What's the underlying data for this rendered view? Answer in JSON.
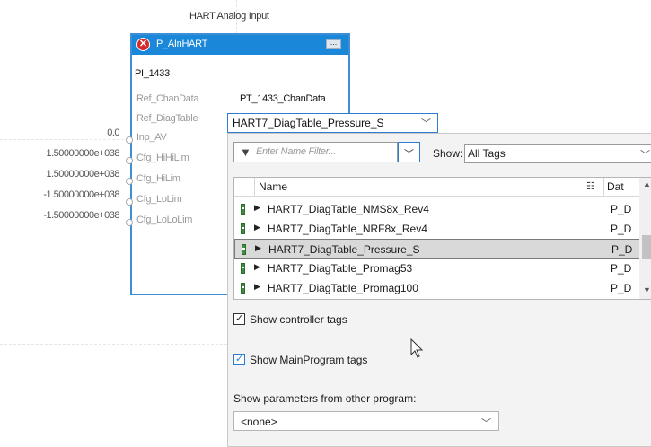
{
  "block": {
    "caption": "HART Analog Input",
    "name": "P_AInHART",
    "menu_dots": "...",
    "tag": "PI_1433",
    "parameters": [
      {
        "label": "Ref_ChanData",
        "value": "PT_1433_ChanData"
      },
      {
        "label": "Ref_DiagTable",
        "value": ""
      },
      {
        "label": "Inp_AV",
        "value": ""
      },
      {
        "label": "Cfg_HiHiLim",
        "value": ""
      },
      {
        "label": "Cfg_HiLim",
        "value": ""
      },
      {
        "label": "Cfg_LoLim",
        "value": ""
      },
      {
        "label": "Cfg_LoLoLim",
        "value": ""
      }
    ],
    "inputs": [
      "0.0",
      "1.50000000e+038",
      "1.50000000e+038",
      "-1.50000000e+038",
      "-1.50000000e+038"
    ]
  },
  "diag_combo": {
    "value": "HART7_DiagTable_Pressure_S"
  },
  "browser": {
    "filter_placeholder": "Enter Name Filter...",
    "show_label": "Show:",
    "show_value": "All Tags",
    "columns": {
      "name": "Name",
      "data_type": "Dat"
    },
    "rows": [
      {
        "name": "HART7_DiagTable_NMS8x_Rev4",
        "type": "P_D",
        "selected": false
      },
      {
        "name": "HART7_DiagTable_NRF8x_Rev4",
        "type": "P_D",
        "selected": false
      },
      {
        "name": "HART7_DiagTable_Pressure_S",
        "type": "P_D",
        "selected": true
      },
      {
        "name": "HART7_DiagTable_Promag53",
        "type": "P_D",
        "selected": false
      },
      {
        "name": "HART7_DiagTable_Promag100",
        "type": "P_D",
        "selected": false
      }
    ],
    "show_controller_tags": {
      "label": "Show controller tags",
      "checked": true
    },
    "show_mainprogram_tags": {
      "label": "Show MainProgram tags",
      "checked": true
    },
    "params_label": "Show parameters from other program:",
    "params_value": "<none>"
  },
  "colors": {
    "block_header": "#1a87d8",
    "block_border": "#3c8fd6",
    "error": "#d72b2b",
    "tag_icon": "#3f8e3f"
  }
}
